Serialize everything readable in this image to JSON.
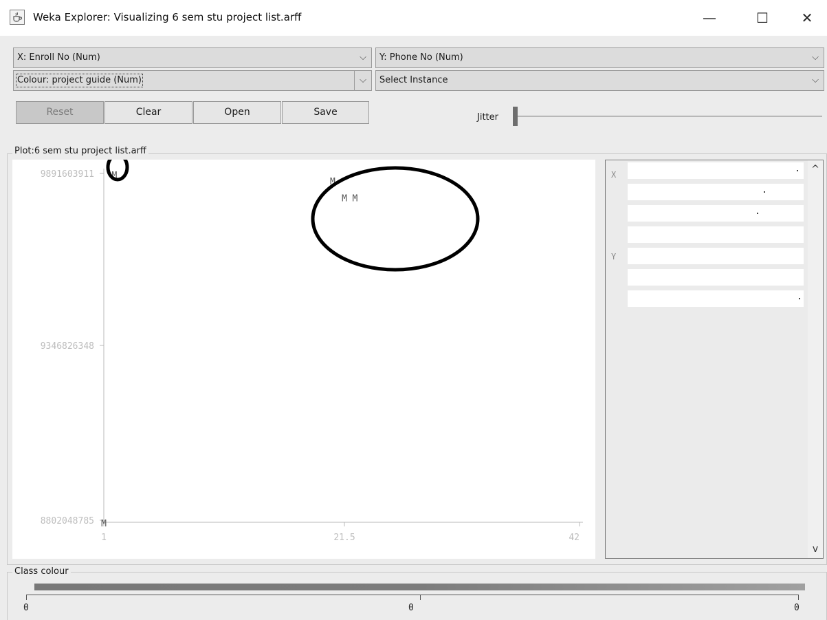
{
  "window": {
    "title": "Weka Explorer: Visualizing 6 sem stu project list.arff",
    "icon": "java-cup-icon",
    "controls": {
      "minimize": "—",
      "maximize": "☐",
      "close": "✕"
    }
  },
  "selectors": {
    "x_axis": "X: Enroll No (Num)",
    "y_axis": "Y: Phone No (Num)",
    "colour": "Colour: project guide (Num)",
    "instance": "Select Instance"
  },
  "buttons": {
    "reset": "Reset",
    "clear": "Clear",
    "open": "Open",
    "save": "Save"
  },
  "jitter": {
    "label": "Jitter",
    "value": 0
  },
  "plot": {
    "label": "Plot:6 sem stu project list.arff",
    "marker": "M"
  },
  "chart_data": {
    "type": "scatter",
    "marker": "M",
    "x_ticks": [
      "1",
      "21.5",
      "42"
    ],
    "y_ticks": [
      "9891603911",
      "9346826348",
      "8802048785"
    ],
    "xlim": [
      1,
      42
    ],
    "ylim": [
      8802048785,
      9891603911
    ],
    "points": [
      {
        "x": 1.9,
        "y": 9891603911
      },
      {
        "x": 20.5,
        "y": 9872000000
      },
      {
        "x": 21.5,
        "y": 9820000000
      },
      {
        "x": 22.4,
        "y": 9820000000
      },
      {
        "x": 1.0,
        "y": 8802048785
      }
    ],
    "annotations": [
      "ellipse around top-left point",
      "ellipse around center cluster"
    ]
  },
  "attribute_panel": {
    "x_label": "X",
    "y_label": "Y",
    "scroll_up": "^",
    "scroll_down": "v",
    "bars": [
      {
        "dot": 0.97
      },
      {
        "dot": 0.78
      },
      {
        "dot": 0.74
      },
      {
        "dot": null
      },
      {
        "dot": null
      },
      {
        "dot": null
      },
      {
        "dot": 0.98
      }
    ]
  },
  "class_colour": {
    "label": "Class colour",
    "ticks": [
      "0",
      "0",
      "0"
    ]
  }
}
